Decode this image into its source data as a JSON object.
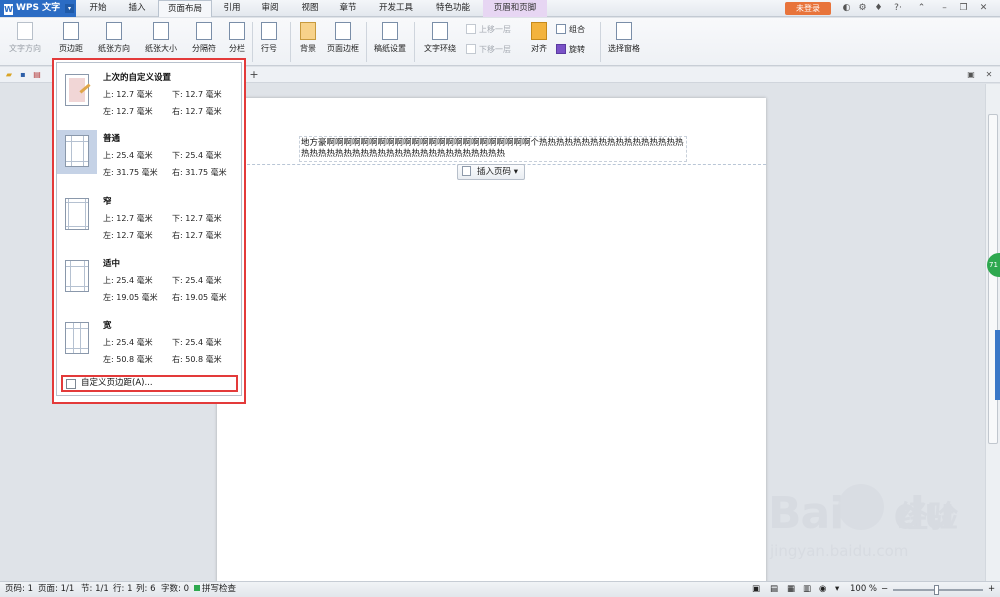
{
  "title_bar": {
    "app_name": "WPS 文字",
    "tabs": [
      "开始",
      "插入",
      "页面布局",
      "引用",
      "审阅",
      "视图",
      "章节",
      "开发工具",
      "特色功能",
      "页眉和页脚"
    ],
    "active_tab": "页面布局",
    "contextual_tab": "页眉和页脚",
    "login_label": "未登录"
  },
  "ribbon": {
    "text_direction": "文字方向",
    "margins": "页边距",
    "orientation": "纸张方向",
    "paper_size": "纸张大小",
    "breaks": "分隔符",
    "columns": "分栏",
    "line_numbers": "行号",
    "background": "背景",
    "page_border": "页面边框",
    "manuscript": "稿纸设置",
    "text_wrap": "文字环绕",
    "bring_forward": "上移一层",
    "send_backward": "下移一层",
    "align": "对齐",
    "group": "组合",
    "rotate": "旋转",
    "selection_pane": "选择窗格"
  },
  "margins_menu": {
    "presets": [
      {
        "name": "上次的自定义设置",
        "top": "上: 12.7 毫米",
        "bottom": "下: 12.7 毫米",
        "left": "左: 12.7 毫米",
        "right": "右: 12.7 毫米"
      },
      {
        "name": "普通",
        "top": "上: 25.4 毫米",
        "bottom": "下: 25.4 毫米",
        "left": "左: 31.75 毫米",
        "right": "右: 31.75 毫米"
      },
      {
        "name": "窄",
        "top": "上: 12.7 毫米",
        "bottom": "下: 12.7 毫米",
        "left": "左: 12.7 毫米",
        "right": "右: 12.7 毫米"
      },
      {
        "name": "适中",
        "top": "上: 25.4 毫米",
        "bottom": "下: 25.4 毫米",
        "left": "左: 19.05 毫米",
        "right": "右: 19.05 毫米"
      },
      {
        "name": "宽",
        "top": "上: 25.4 毫米",
        "bottom": "下: 25.4 毫米",
        "left": "左: 50.8 毫米",
        "right": "右: 50.8 毫米"
      }
    ],
    "custom_label": "自定义页边距(A)..."
  },
  "document": {
    "header_text": "地方豪啊啊啊啊啊啊啊啊啊啊啊啊啊啊啊啊啊啊啊啊啊啊啊啊个热热热热热热热热热热热热热热热热热热热热热热热热热热热热热热热热热热热热热热热热热",
    "insert_page_number": "插入页码"
  },
  "status_bar": {
    "page_num": "页码: 1",
    "pages": "页面: 1/1",
    "section": "节: 1/1",
    "line": "行: 1",
    "column": "列: 6",
    "word_count": "字数: 0",
    "spell_check": "拼写检查",
    "zoom": "100 %"
  },
  "side_badge": "71",
  "watermark": {
    "brand": "Bai",
    "brand2": "du",
    "cn": "经验",
    "url": "jingyan.baidu.com"
  }
}
